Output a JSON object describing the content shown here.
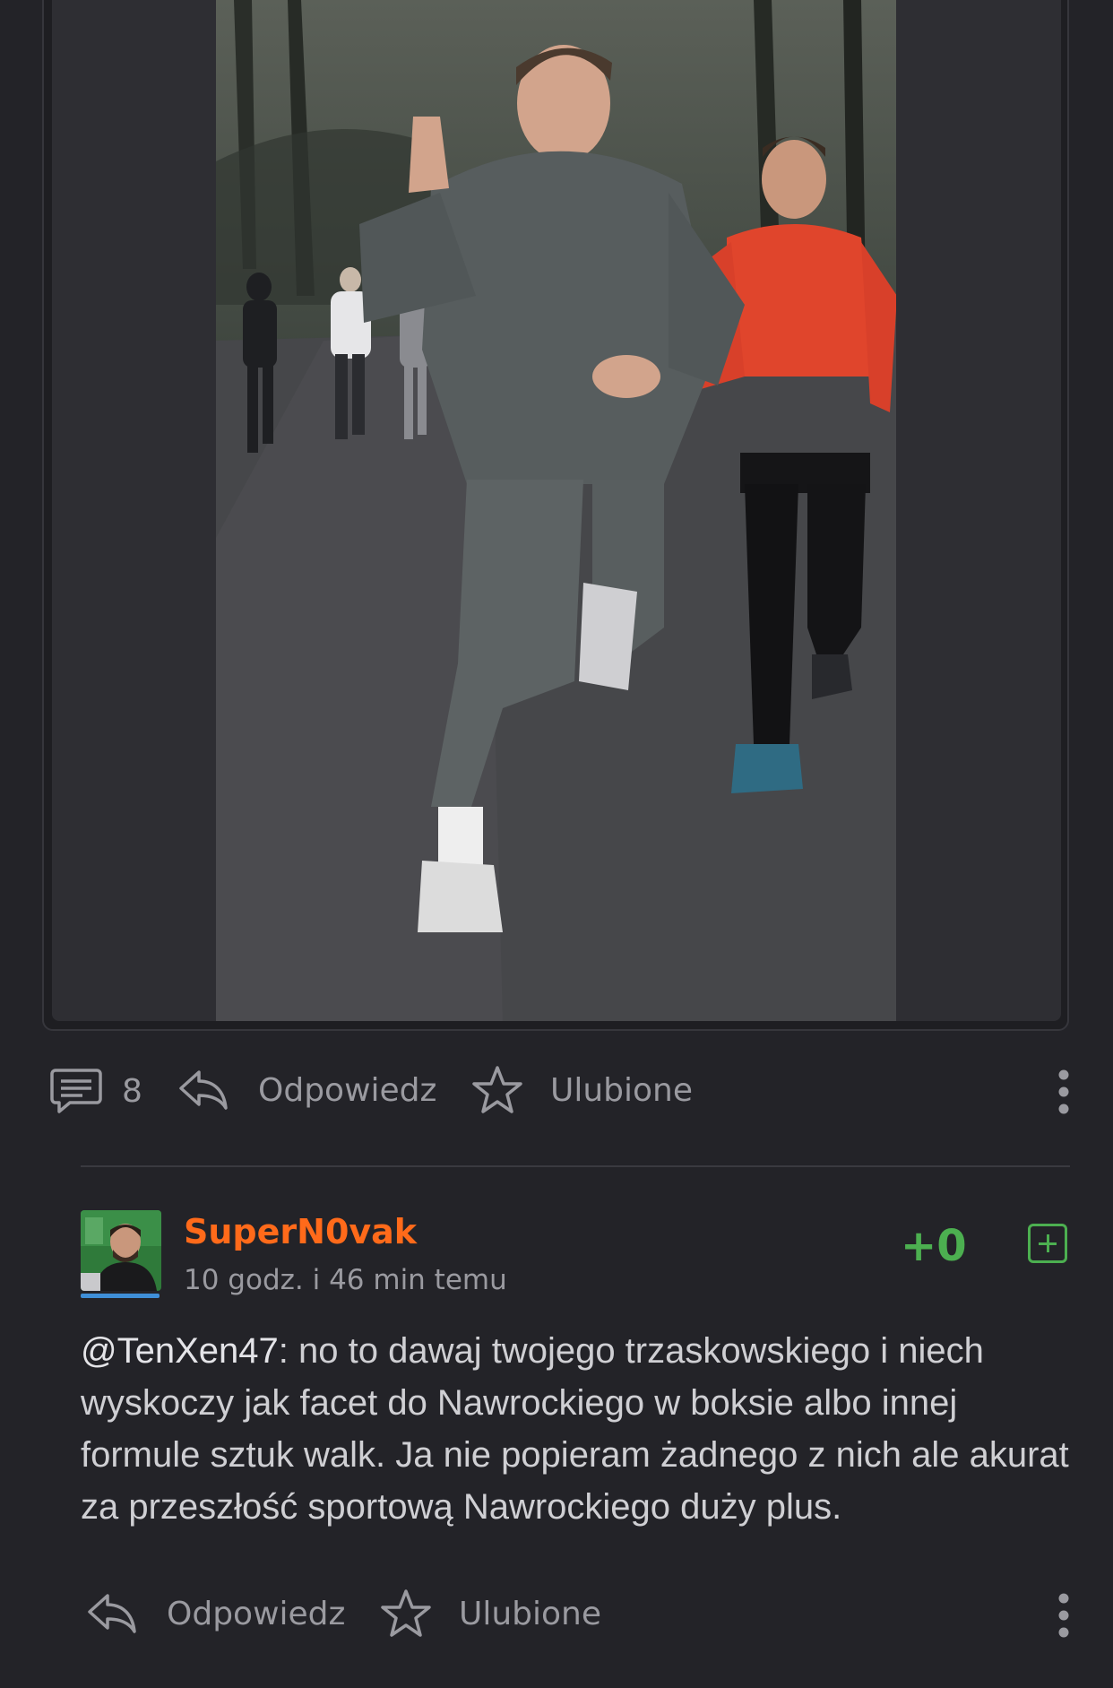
{
  "post": {
    "comment_count": "8",
    "reply_label": "Odpowiedz",
    "favorite_label": "Ulubione",
    "icons": {
      "comments": "comment-icon",
      "reply": "reply-arrow-icon",
      "favorite": "star-icon",
      "more": "more-vertical-icon"
    }
  },
  "comment": {
    "username": "SuperN0vak",
    "timestamp": "10 godz. i 46 min temu",
    "score": "+0",
    "mention": "@TenXen47",
    "text": ": no to dawaj twojego trzaskowskiego i niech wyskoczy jak facet do Nawrockiego w boksie albo innej formule sztuk walk. Ja nie popieram żadnego z nich ale akurat za przeszłość sportową Nawrockiego duży plus.",
    "reply_label": "Odpowiedz",
    "favorite_label": "Ulubione",
    "colors": {
      "username": "#ff6a1a",
      "score": "#4caf50",
      "avatar_bar": "#3f8fd8"
    }
  }
}
